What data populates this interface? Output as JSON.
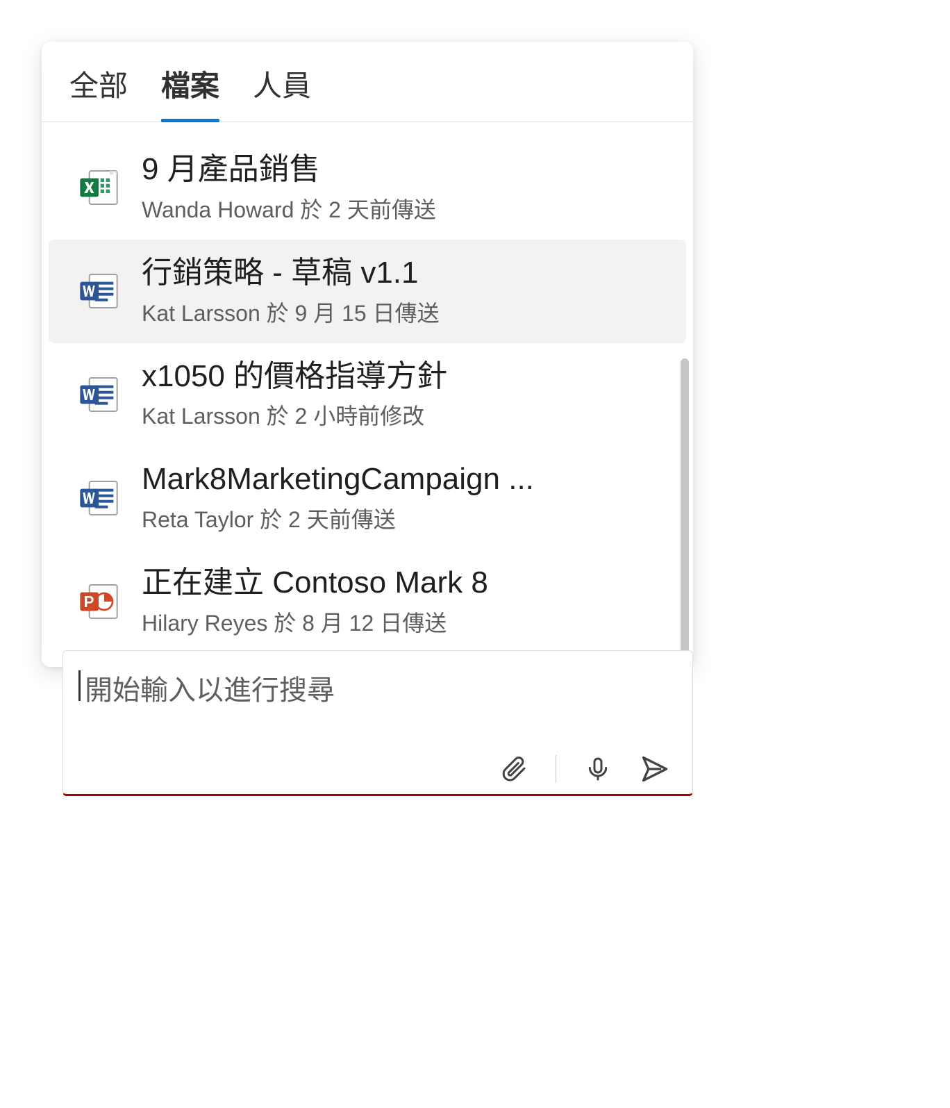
{
  "tabs": {
    "all": "全部",
    "files": "檔案",
    "people": "人員",
    "activeIndex": 1
  },
  "files": [
    {
      "icon": "excel",
      "title": "9 月產品銷售",
      "subtitle": "Wanda Howard 於 2 天前傳送"
    },
    {
      "icon": "word",
      "title": "行銷策略 - 草稿 v1.1",
      "subtitle": "Kat Larsson 於 9 月 15 日傳送",
      "hovered": true
    },
    {
      "icon": "word",
      "title": "x1050 的價格指導方針",
      "subtitle": "Kat Larsson 於 2 小時前修改"
    },
    {
      "icon": "word",
      "title": "Mark8MarketingCampaign ...",
      "subtitle": "Reta Taylor 於 2 天前傳送"
    },
    {
      "icon": "powerpoint",
      "title": "正在建立 Contoso Mark 8",
      "subtitle": "Hilary Reyes 於 8 月 12 日傳送"
    }
  ],
  "compose": {
    "placeholder": "開始輸入以進行搜尋"
  }
}
